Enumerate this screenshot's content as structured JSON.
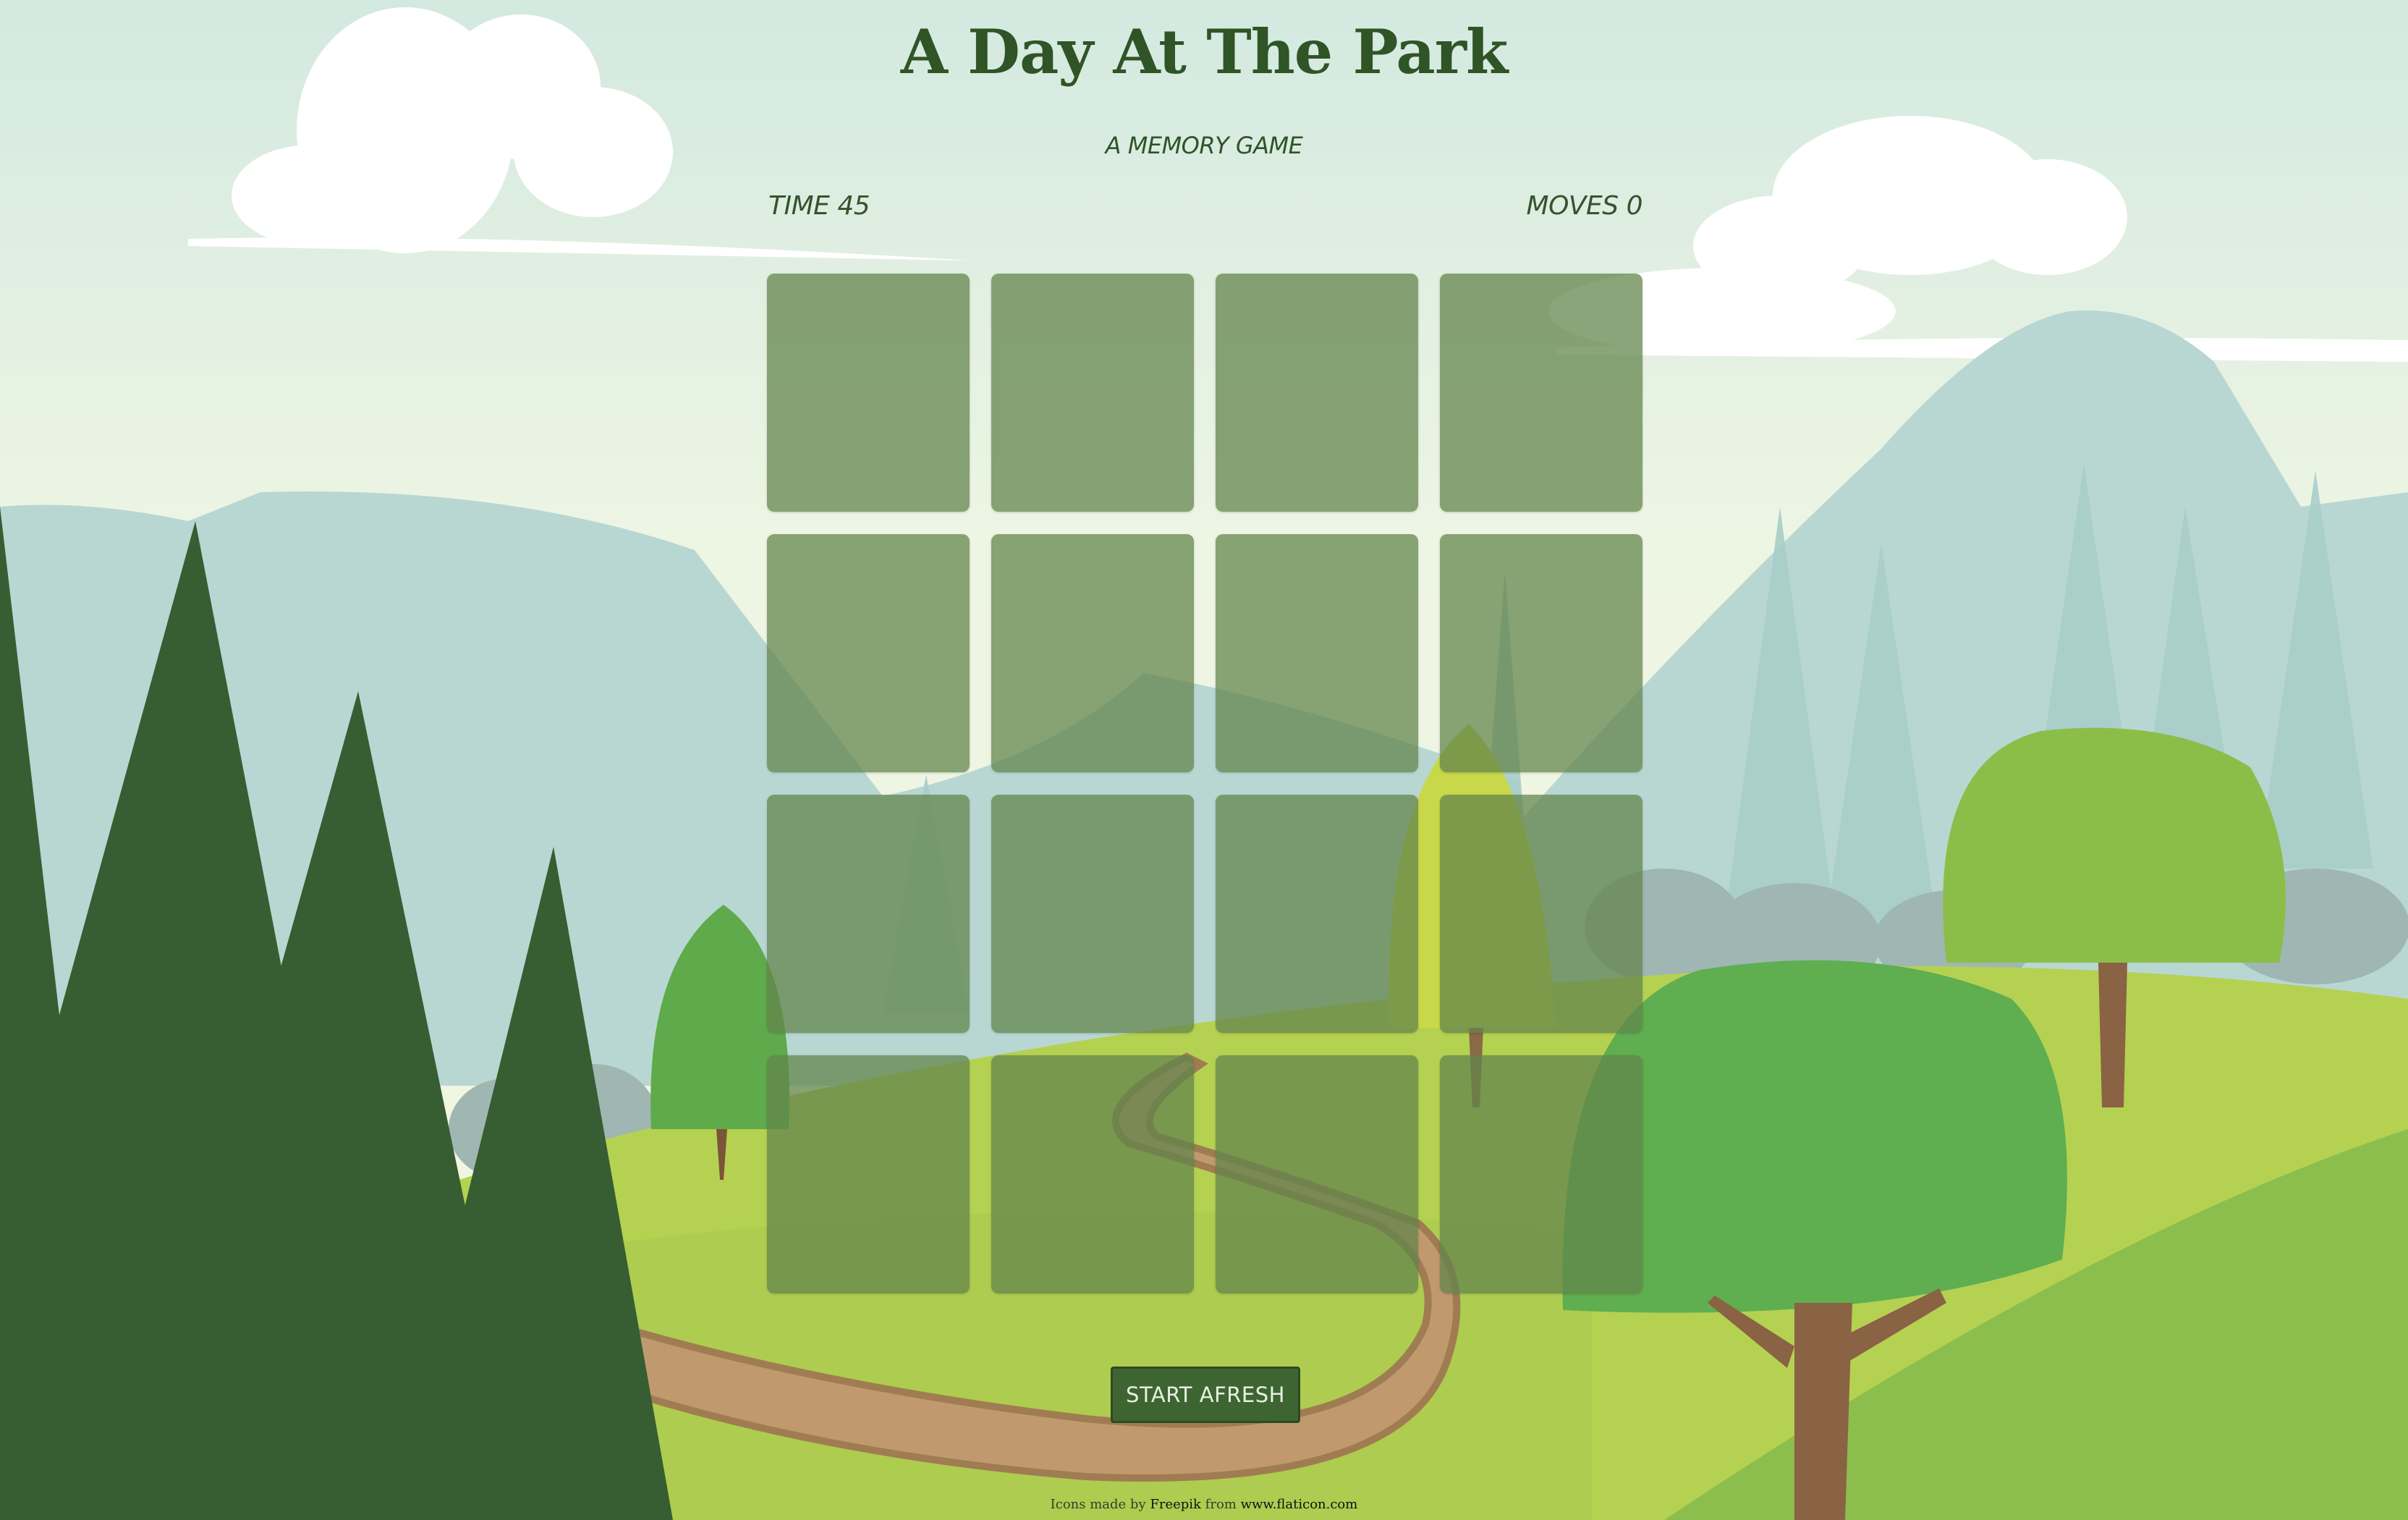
{
  "header": {
    "title": "A Day At The Park",
    "subtitle": "A MEMORY GAME"
  },
  "stats": {
    "time": "TIME 45",
    "moves": "MOVES 0"
  },
  "board": {
    "rows": 4,
    "columns": 4,
    "cards_face_down": 16
  },
  "controls": {
    "restart_label": "START AFRESH"
  },
  "footer": {
    "prefix": "Icons made by",
    "author": "Freepik",
    "middle": "from",
    "site": "www.flaticon.com"
  },
  "colors": {
    "title_text": "#2f5426",
    "card_back": "#62844c",
    "button_bg": "#3e6432"
  }
}
